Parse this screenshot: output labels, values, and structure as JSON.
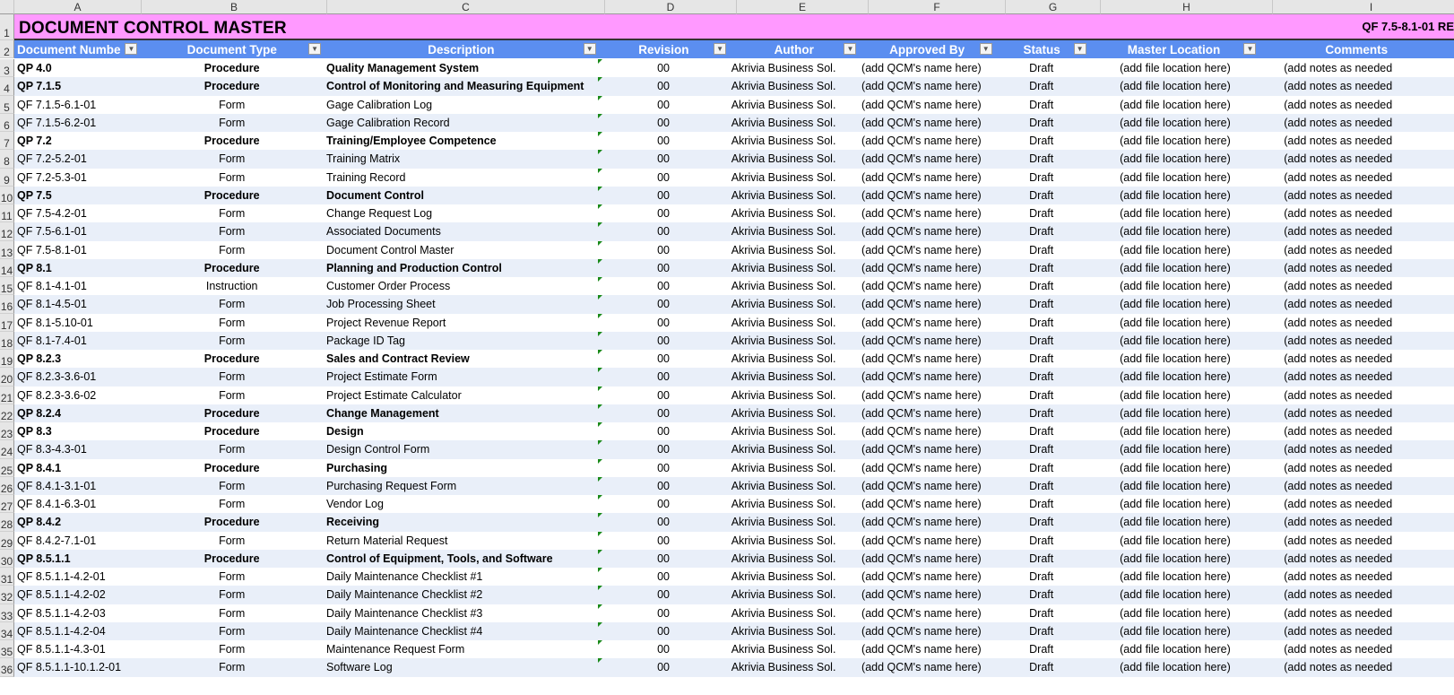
{
  "columns": [
    "A",
    "B",
    "C",
    "D",
    "E",
    "F",
    "G",
    "H",
    "I"
  ],
  "title": "DOCUMENT CONTROL MASTER",
  "form_ref": "QF 7.5-8.1-01 RE",
  "headers": [
    "Document Numbe",
    "Document Type",
    "Description",
    "Revision",
    "Author",
    "Approved By",
    "Status",
    "Master Location",
    "Comments"
  ],
  "defaults": {
    "revision": "00",
    "author": "Akrivia Business Sol.",
    "approved_by": "(add QCM's name here)",
    "status": "Draft",
    "location": "(add file location here)",
    "comments": "(add notes as needed"
  },
  "rows": [
    [
      "QP 4.0",
      "Procedure",
      "Quality Management System"
    ],
    [
      "QP 7.1.5",
      "Procedure",
      "Control of Monitoring and Measuring Equipment"
    ],
    [
      "QF 7.1.5-6.1-01",
      "Form",
      "Gage Calibration Log"
    ],
    [
      "QF 7.1.5-6.2-01",
      "Form",
      "Gage Calibration Record"
    ],
    [
      "QP 7.2",
      "Procedure",
      "Training/Employee Competence"
    ],
    [
      "QF 7.2-5.2-01",
      "Form",
      "Training Matrix"
    ],
    [
      "QF 7.2-5.3-01",
      "Form",
      "Training Record"
    ],
    [
      "QP 7.5",
      "Procedure",
      "Document Control"
    ],
    [
      "QF 7.5-4.2-01",
      "Form",
      "Change Request Log"
    ],
    [
      "QF 7.5-6.1-01",
      "Form",
      "Associated Documents"
    ],
    [
      "QF 7.5-8.1-01",
      "Form",
      "Document Control Master"
    ],
    [
      "QP 8.1",
      "Procedure",
      "Planning and Production Control"
    ],
    [
      "QF 8.1-4.1-01",
      "Instruction",
      "Customer Order Process"
    ],
    [
      "QF 8.1-4.5-01",
      "Form",
      "Job Processing Sheet"
    ],
    [
      "QF 8.1-5.10-01",
      "Form",
      "Project Revenue Report"
    ],
    [
      "QF 8.1-7.4-01",
      "Form",
      "Package ID Tag"
    ],
    [
      "QP 8.2.3",
      "Procedure",
      "Sales and Contract Review"
    ],
    [
      "QF 8.2.3-3.6-01",
      "Form",
      "Project Estimate Form"
    ],
    [
      "QF 8.2.3-3.6-02",
      "Form",
      "Project Estimate Calculator"
    ],
    [
      "QP 8.2.4",
      "Procedure",
      "Change Management"
    ],
    [
      "QP 8.3",
      "Procedure",
      "Design"
    ],
    [
      "QF 8.3-4.3-01",
      "Form",
      "Design Control Form"
    ],
    [
      "QP 8.4.1",
      "Procedure",
      "Purchasing"
    ],
    [
      "QF 8.4.1-3.1-01",
      "Form",
      "Purchasing Request Form"
    ],
    [
      "QF 8.4.1-6.3-01",
      "Form",
      "Vendor Log"
    ],
    [
      "QP 8.4.2",
      "Procedure",
      "Receiving"
    ],
    [
      "QF 8.4.2-7.1-01",
      "Form",
      "Return Material Request"
    ],
    [
      "QP 8.5.1.1",
      "Procedure",
      "Control of Equipment, Tools, and Software"
    ],
    [
      "QF 8.5.1.1-4.2-01",
      "Form",
      "Daily Maintenance Checklist #1"
    ],
    [
      "QF 8.5.1.1-4.2-02",
      "Form",
      "Daily Maintenance Checklist #2"
    ],
    [
      "QF 8.5.1.1-4.2-03",
      "Form",
      "Daily Maintenance Checklist #3"
    ],
    [
      "QF 8.5.1.1-4.2-04",
      "Form",
      "Daily Maintenance Checklist #4"
    ],
    [
      "QF 8.5.1.1-4.3-01",
      "Form",
      "Maintenance Request Form"
    ],
    [
      "QF 8.5.1.1-10.1.2-01",
      "Form",
      "Software Log"
    ]
  ],
  "colors": {
    "title_bg": "#ff99ff",
    "header_bg": "#5b8ef0",
    "band": "#e9eff9",
    "error_flag": "#1a8a1a"
  }
}
